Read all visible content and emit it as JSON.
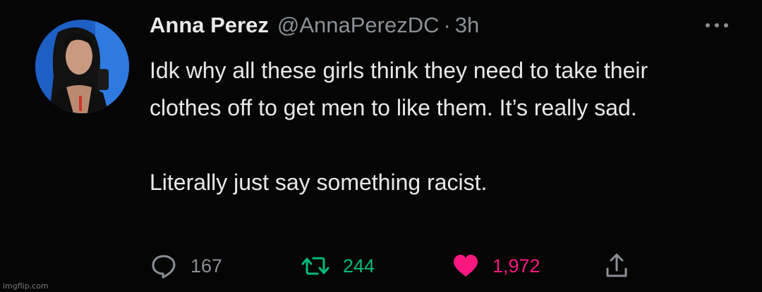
{
  "tweet": {
    "author_name": "Anna Perez",
    "handle": "@AnnaPerezDC",
    "separator": "·",
    "time": "3h",
    "text_paragraph_1": "Idk why all these girls think they need to take their clothes off to get men to like them. It’s really sad.",
    "text_paragraph_2": "Literally just say something racist.",
    "reply_count": "167",
    "retweet_count": "244",
    "like_count": "1,972"
  },
  "icons": {
    "more": "more-options-icon",
    "reply": "reply-icon",
    "retweet": "retweet-icon",
    "like": "heart-icon",
    "share": "share-icon"
  },
  "colors": {
    "background": "#000000",
    "text": "#e7e9ea",
    "muted": "#8b9096",
    "retweet": "#00ba7c",
    "like": "#f91880"
  },
  "watermark": "imgflip.com"
}
